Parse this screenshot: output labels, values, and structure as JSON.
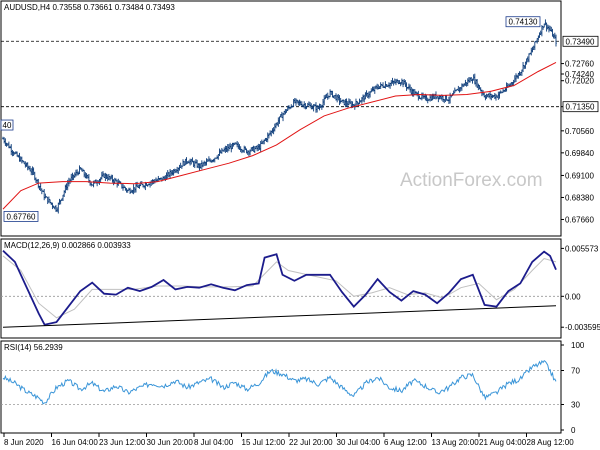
{
  "chart_data": [
    {
      "type": "candlestick",
      "header": "AUDUSD,H4  0.73558 0.73661 0.73484 0.73493",
      "watermark": "ActionForex.com",
      "ylim": [
        0.6725,
        0.7435
      ],
      "yticks": [
        0.7242,
        0.7276,
        0.722,
        0.7135,
        0.7056,
        0.6984,
        0.691,
        0.6838,
        0.6766
      ],
      "ytick_labels": [
        "0.74240",
        "0.72760",
        "0.72020",
        "0.71350",
        "0.70560",
        "0.69840",
        "0.69100",
        "0.68380",
        "0.67660"
      ],
      "hlines": [
        {
          "value": 0.7349,
          "label": "0.73490",
          "style": "dashed"
        },
        {
          "value": 0.7135,
          "label": "0.71350",
          "style": "dashed"
        }
      ],
      "box_labels": [
        {
          "text": "0.74130",
          "value": 0.7413,
          "at": "top"
        },
        {
          "text": "0.67760",
          "value": 0.6776,
          "at": "bottom-left"
        },
        {
          "text": "40",
          "value": 0.7075,
          "at": "left-edge"
        }
      ],
      "x_labels": [
        "8 Jun 2020",
        "16 Jun 04:00",
        "23 Jun 12:00",
        "30 Jun 20:00",
        "8 Jul 04:00",
        "15 Jul 12:00",
        "22 Jul 20:00",
        "30 Jul 04:00",
        "6 Aug 12:00",
        "13 Aug 20:00",
        "21 Aug 04:00",
        "28 Aug 12:00"
      ],
      "close_path": [
        [
          0,
          0.703
        ],
        [
          2,
          0.698
        ],
        [
          5,
          0.692
        ],
        [
          7,
          0.684
        ],
        [
          9,
          0.68
        ],
        [
          11,
          0.689
        ],
        [
          13,
          0.693
        ],
        [
          15,
          0.688
        ],
        [
          17,
          0.691
        ],
        [
          19,
          0.689
        ],
        [
          21,
          0.686
        ],
        [
          23,
          0.6875
        ],
        [
          25,
          0.689
        ],
        [
          27,
          0.69
        ],
        [
          29,
          0.693
        ],
        [
          31,
          0.696
        ],
        [
          33,
          0.694
        ],
        [
          35,
          0.696
        ],
        [
          37,
          0.699
        ],
        [
          39,
          0.701
        ],
        [
          41,
          0.699
        ],
        [
          43,
          0.7
        ],
        [
          45,
          0.705
        ],
        [
          47,
          0.711
        ],
        [
          49,
          0.715
        ],
        [
          51,
          0.714
        ],
        [
          53,
          0.713
        ],
        [
          55,
          0.718
        ],
        [
          57,
          0.715
        ],
        [
          59,
          0.714
        ],
        [
          61,
          0.717
        ],
        [
          63,
          0.72
        ],
        [
          65,
          0.721
        ],
        [
          67,
          0.722
        ],
        [
          69,
          0.718
        ],
        [
          71,
          0.716
        ],
        [
          73,
          0.717
        ],
        [
          75,
          0.716
        ],
        [
          77,
          0.72
        ],
        [
          79,
          0.723
        ],
        [
          81,
          0.717
        ],
        [
          83,
          0.717
        ],
        [
          85,
          0.72
        ],
        [
          87,
          0.725
        ],
        [
          89,
          0.732
        ],
        [
          91,
          0.741
        ],
        [
          92,
          0.7385
        ],
        [
          93,
          0.7349
        ]
      ],
      "ma_path": [
        [
          0,
          0.68
        ],
        [
          3,
          0.686
        ],
        [
          6,
          0.6885
        ],
        [
          10,
          0.689
        ],
        [
          14,
          0.689
        ],
        [
          18,
          0.6885
        ],
        [
          22,
          0.6883
        ],
        [
          26,
          0.689
        ],
        [
          30,
          0.691
        ],
        [
          34,
          0.693
        ],
        [
          38,
          0.695
        ],
        [
          42,
          0.6975
        ],
        [
          46,
          0.701
        ],
        [
          50,
          0.706
        ],
        [
          54,
          0.7105
        ],
        [
          58,
          0.713
        ],
        [
          62,
          0.715
        ],
        [
          66,
          0.717
        ],
        [
          70,
          0.7175
        ],
        [
          74,
          0.7172
        ],
        [
          78,
          0.7175
        ],
        [
          82,
          0.7185
        ],
        [
          86,
          0.7205
        ],
        [
          90,
          0.725
        ],
        [
          93,
          0.728
        ]
      ],
      "colors": {
        "candles": "#0a3a78",
        "ma": "#e11414"
      }
    },
    {
      "type": "line",
      "header": "MACD(12,26,9) 0.002866 0.003933",
      "ylim": [
        -0.0045,
        0.0062
      ],
      "yticks": [
        0.005573,
        0,
        -0.003595
      ],
      "ytick_labels": [
        "0.005573",
        "0.00",
        "-0.003595"
      ],
      "zero_line": 0,
      "macd_path": [
        [
          0,
          0.0053
        ],
        [
          2,
          0.004
        ],
        [
          4,
          0.001
        ],
        [
          6,
          -0.002
        ],
        [
          7,
          -0.0033
        ],
        [
          9,
          -0.003
        ],
        [
          11,
          -0.0012
        ],
        [
          13,
          0.0006
        ],
        [
          15,
          0.0016
        ],
        [
          17,
          0.0003
        ],
        [
          19,
          0.0002
        ],
        [
          21,
          0.001
        ],
        [
          23,
          0.0006
        ],
        [
          25,
          0.0011
        ],
        [
          27,
          0.0019
        ],
        [
          29,
          0.0008
        ],
        [
          31,
          0.0011
        ],
        [
          33,
          0.001
        ],
        [
          35,
          0.0014
        ],
        [
          37,
          0.001
        ],
        [
          39,
          0.0007
        ],
        [
          41,
          0.0013
        ],
        [
          43,
          0.0015
        ],
        [
          44,
          0.0045
        ],
        [
          46,
          0.0049
        ],
        [
          47,
          0.0025
        ],
        [
          49,
          0.0018
        ],
        [
          51,
          0.0025
        ],
        [
          53,
          0.0025
        ],
        [
          55,
          0.0025
        ],
        [
          57,
          0.0005
        ],
        [
          59,
          -0.0012
        ],
        [
          61,
          0.0002
        ],
        [
          63,
          0.002
        ],
        [
          65,
          0.0005
        ],
        [
          67,
          -0.0005
        ],
        [
          69,
          0.0006
        ],
        [
          71,
          0.0002
        ],
        [
          73,
          -0.0008
        ],
        [
          75,
          0.0004
        ],
        [
          77,
          0.002
        ],
        [
          79,
          0.0025
        ],
        [
          81,
          -0.001
        ],
        [
          83,
          -0.0012
        ],
        [
          85,
          0.0006
        ],
        [
          87,
          0.0015
        ],
        [
          89,
          0.004
        ],
        [
          91,
          0.0052
        ],
        [
          92,
          0.0047
        ],
        [
          93,
          0.0031
        ]
      ],
      "signal_path": [
        [
          0,
          0.0047
        ],
        [
          3,
          0.003
        ],
        [
          6,
          -0.0008
        ],
        [
          9,
          -0.0025
        ],
        [
          12,
          -0.0015
        ],
        [
          15,
          0.0008
        ],
        [
          18,
          0.0008
        ],
        [
          22,
          0.0008
        ],
        [
          26,
          0.0012
        ],
        [
          30,
          0.0012
        ],
        [
          34,
          0.0011
        ],
        [
          38,
          0.0011
        ],
        [
          42,
          0.0012
        ],
        [
          44,
          0.0026
        ],
        [
          46,
          0.004
        ],
        [
          48,
          0.003
        ],
        [
          52,
          0.0024
        ],
        [
          56,
          0.0018
        ],
        [
          59,
          0.0
        ],
        [
          62,
          0.0004
        ],
        [
          65,
          0.001
        ],
        [
          68,
          0.0002
        ],
        [
          71,
          0.0004
        ],
        [
          74,
          -0.0002
        ],
        [
          77,
          0.001
        ],
        [
          80,
          0.0015
        ],
        [
          83,
          -0.0004
        ],
        [
          86,
          0.0008
        ],
        [
          89,
          0.003
        ],
        [
          91,
          0.0044
        ],
        [
          93,
          0.004
        ]
      ],
      "trendline": [
        [
          0,
          -0.0036
        ],
        [
          93,
          -0.0011
        ]
      ],
      "colors": {
        "macd": "#1c1c8c",
        "signal": "#c0c0c0",
        "trend": "#000000"
      }
    },
    {
      "type": "line",
      "header": "RSI(14) 56.2939",
      "ylim": [
        0,
        100
      ],
      "yticks": [
        100,
        70,
        30,
        0
      ],
      "ytick_labels": [
        "100",
        "70",
        "30",
        "0"
      ],
      "levels": [
        70,
        30
      ],
      "rsi_path": [
        [
          0,
          62
        ],
        [
          2,
          55
        ],
        [
          4,
          45
        ],
        [
          6,
          38
        ],
        [
          7,
          32
        ],
        [
          9,
          50
        ],
        [
          11,
          58
        ],
        [
          13,
          48
        ],
        [
          15,
          55
        ],
        [
          17,
          45
        ],
        [
          19,
          52
        ],
        [
          21,
          44
        ],
        [
          23,
          50
        ],
        [
          25,
          55
        ],
        [
          27,
          52
        ],
        [
          29,
          58
        ],
        [
          31,
          50
        ],
        [
          33,
          56
        ],
        [
          35,
          60
        ],
        [
          37,
          50
        ],
        [
          39,
          56
        ],
        [
          41,
          48
        ],
        [
          43,
          55
        ],
        [
          45,
          70
        ],
        [
          47,
          66
        ],
        [
          49,
          58
        ],
        [
          51,
          60
        ],
        [
          53,
          54
        ],
        [
          55,
          62
        ],
        [
          57,
          50
        ],
        [
          59,
          40
        ],
        [
          61,
          55
        ],
        [
          63,
          62
        ],
        [
          65,
          50
        ],
        [
          67,
          46
        ],
        [
          69,
          58
        ],
        [
          71,
          52
        ],
        [
          73,
          44
        ],
        [
          75,
          50
        ],
        [
          77,
          62
        ],
        [
          79,
          65
        ],
        [
          81,
          38
        ],
        [
          83,
          44
        ],
        [
          85,
          55
        ],
        [
          87,
          60
        ],
        [
          89,
          74
        ],
        [
          91,
          80
        ],
        [
          92,
          70
        ],
        [
          93,
          56
        ]
      ],
      "colors": {
        "rsi": "#3a95d8"
      }
    }
  ]
}
